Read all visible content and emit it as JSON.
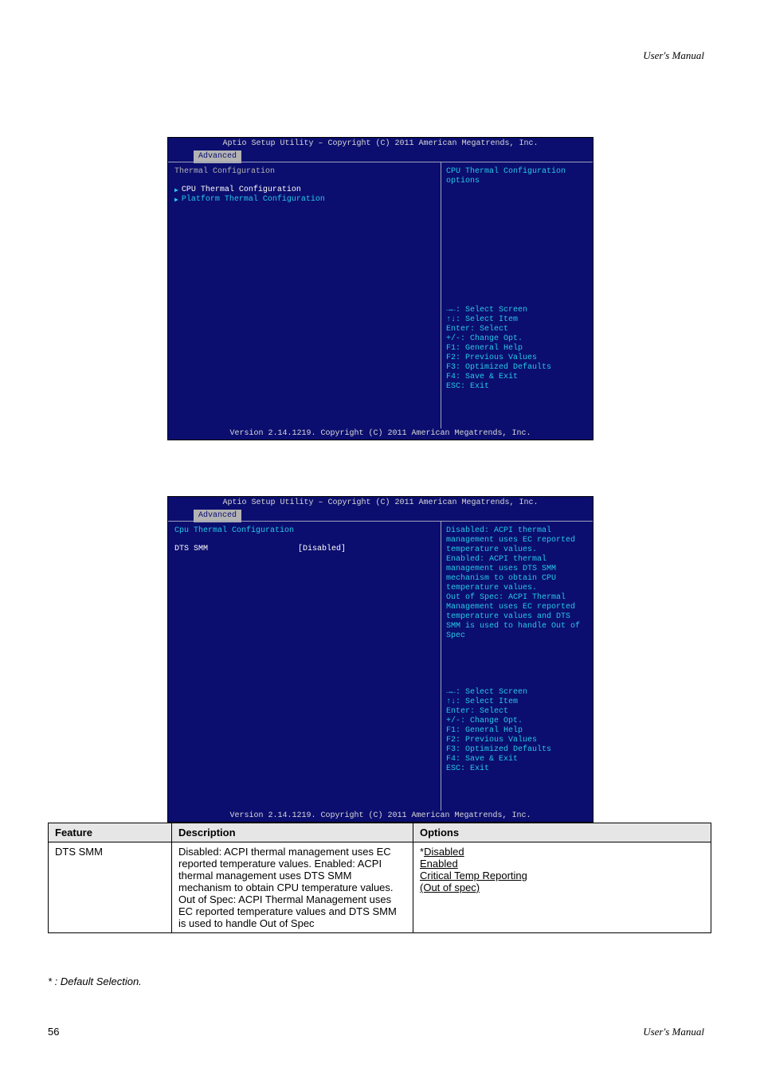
{
  "page_header": "User's Manual",
  "page_footer": "User's Manual",
  "page_number": "56",
  "default_note": "* : Default Selection.",
  "caption1": "Thermal Configuration",
  "bios_title": "Aptio Setup Utility – Copyright (C) 2011 American Megatrends, Inc.",
  "bios_footer": "Version 2.14.1219. Copyright (C) 2011 American Megatrends, Inc.",
  "tab_label": "Advanced",
  "screen1": {
    "heading": "Thermal Configuration",
    "items": [
      "CPU Thermal Configuration",
      "Platform Thermal Configuration"
    ],
    "help": "CPU Thermal Configuration options"
  },
  "screen2": {
    "heading": "Cpu Thermal Configuration",
    "option_label": "DTS SMM",
    "option_value": "[Disabled]",
    "help": "Disabled: ACPI thermal management uses EC reported temperature values.\nEnabled: ACPI thermal management uses DTS SMM mechanism to obtain CPU temperature values.\nOut of Spec: ACPI Thermal Management uses EC reported temperature values and DTS SMM is used to handle Out of Spec"
  },
  "keys": [
    "→←: Select Screen",
    "↑↓: Select Item",
    "Enter: Select",
    "+/-: Change Opt.",
    "F1: General Help",
    "F2: Previous Values",
    "F3: Optimized Defaults",
    "F4: Save & Exit",
    "ESC: Exit"
  ],
  "table": {
    "headers": [
      "Feature",
      "Description",
      "Options"
    ],
    "row": {
      "feature": "DTS SMM",
      "description": "Disabled: ACPI thermal management uses EC reported temperature values. Enabled: ACPI thermal management uses DTS SMM mechanism to obtain CPU temperature values. Out of Spec: ACPI Thermal Management uses EC reported temperature values and DTS SMM is used to handle Out of Spec",
      "opt1_prefix": "*",
      "opt1": "Disabled",
      "opt2": "Enabled",
      "opt3_line1": "Critical Temp Reporting",
      "opt3_line2": "(Out of spec)"
    }
  }
}
